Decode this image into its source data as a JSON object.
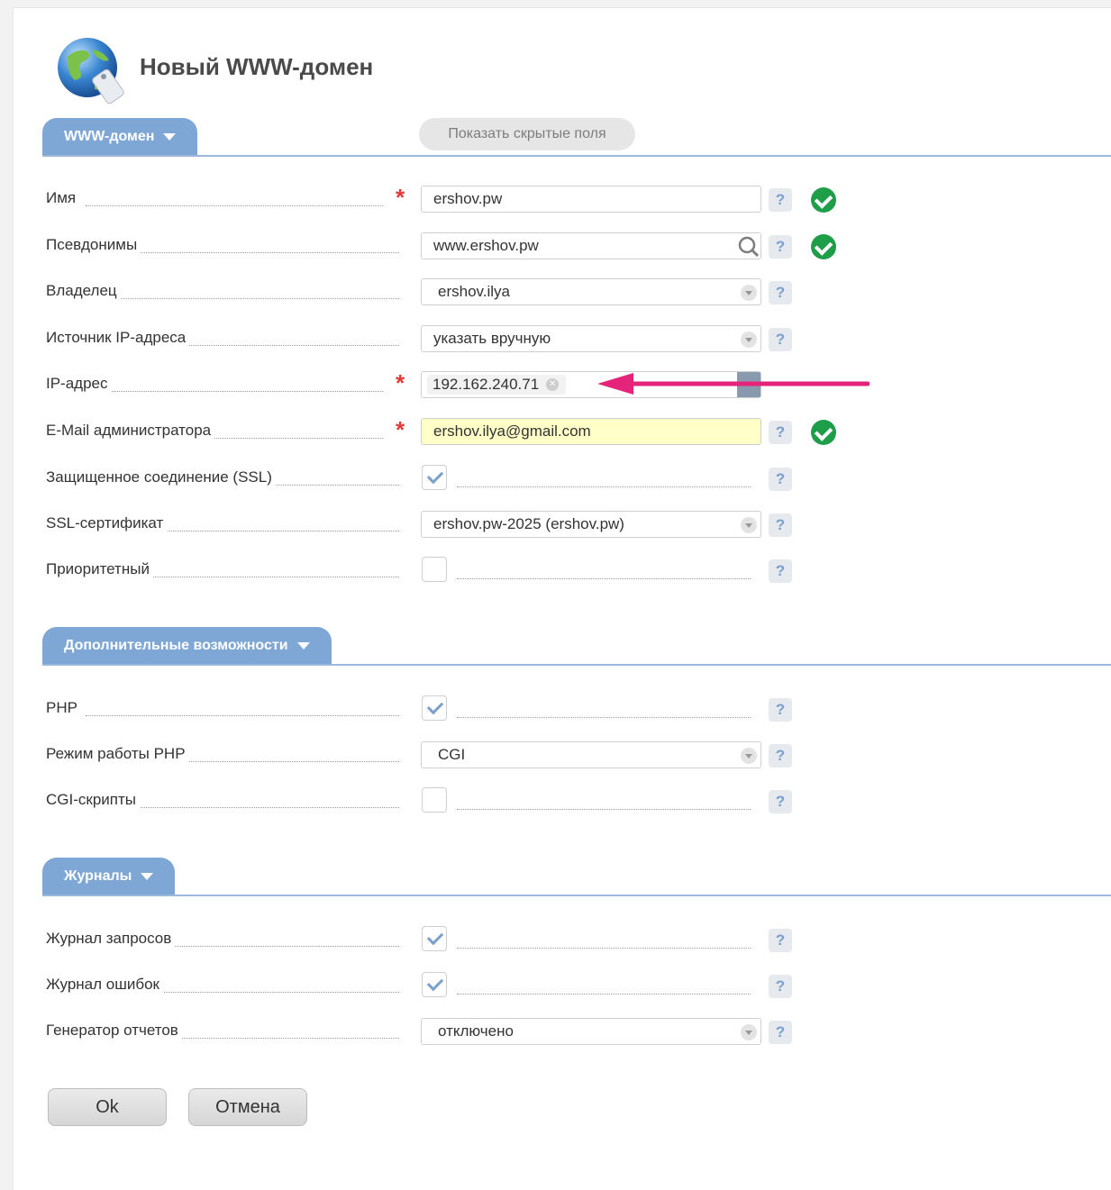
{
  "title": "Новый WWW-домен",
  "colors": {
    "tab": "#7fa7d6",
    "ok": "#1f9e49",
    "required": "#e23a3a",
    "arrow": "#e6237a"
  },
  "sections": {
    "www": {
      "label": "WWW-домен",
      "show_hidden": "Показать скрытые поля"
    },
    "extra": {
      "label": "Дополнительные возможности"
    },
    "logs": {
      "label": "Журналы"
    }
  },
  "fields": {
    "name": {
      "label": "Имя",
      "value": "ershov.pw"
    },
    "aliases": {
      "label": "Псевдонимы",
      "value": "www.ershov.pw"
    },
    "owner": {
      "label": "Владелец",
      "value": "ershov.ilya"
    },
    "ip_source": {
      "label": "Источник IP-адреса",
      "value": "указать вручную"
    },
    "ip": {
      "label": "IP-адрес",
      "value": "192.162.240.71"
    },
    "email": {
      "label": "E-Mail администратора",
      "value": "ershov.ilya@gmail.com"
    },
    "ssl": {
      "label": "Защищенное соединение (SSL)",
      "checked": true
    },
    "ssl_cert": {
      "label": "SSL-сертификат",
      "value": "ershov.pw-2025 (ershov.pw)"
    },
    "priority": {
      "label": "Приоритетный",
      "checked": false
    },
    "php": {
      "label": "PHP",
      "checked": true
    },
    "php_mode": {
      "label": "Режим работы PHP",
      "value": "CGI"
    },
    "cgi": {
      "label": "CGI-скрипты",
      "checked": false
    },
    "access_log": {
      "label": "Журнал запросов",
      "checked": true
    },
    "error_log": {
      "label": "Журнал ошибок",
      "checked": true
    },
    "report_gen": {
      "label": "Генератор отчетов",
      "value": "отключено"
    }
  },
  "required_mark": "*",
  "help_mark": "?",
  "buttons": {
    "ok": "Ok",
    "cancel": "Отмена"
  }
}
